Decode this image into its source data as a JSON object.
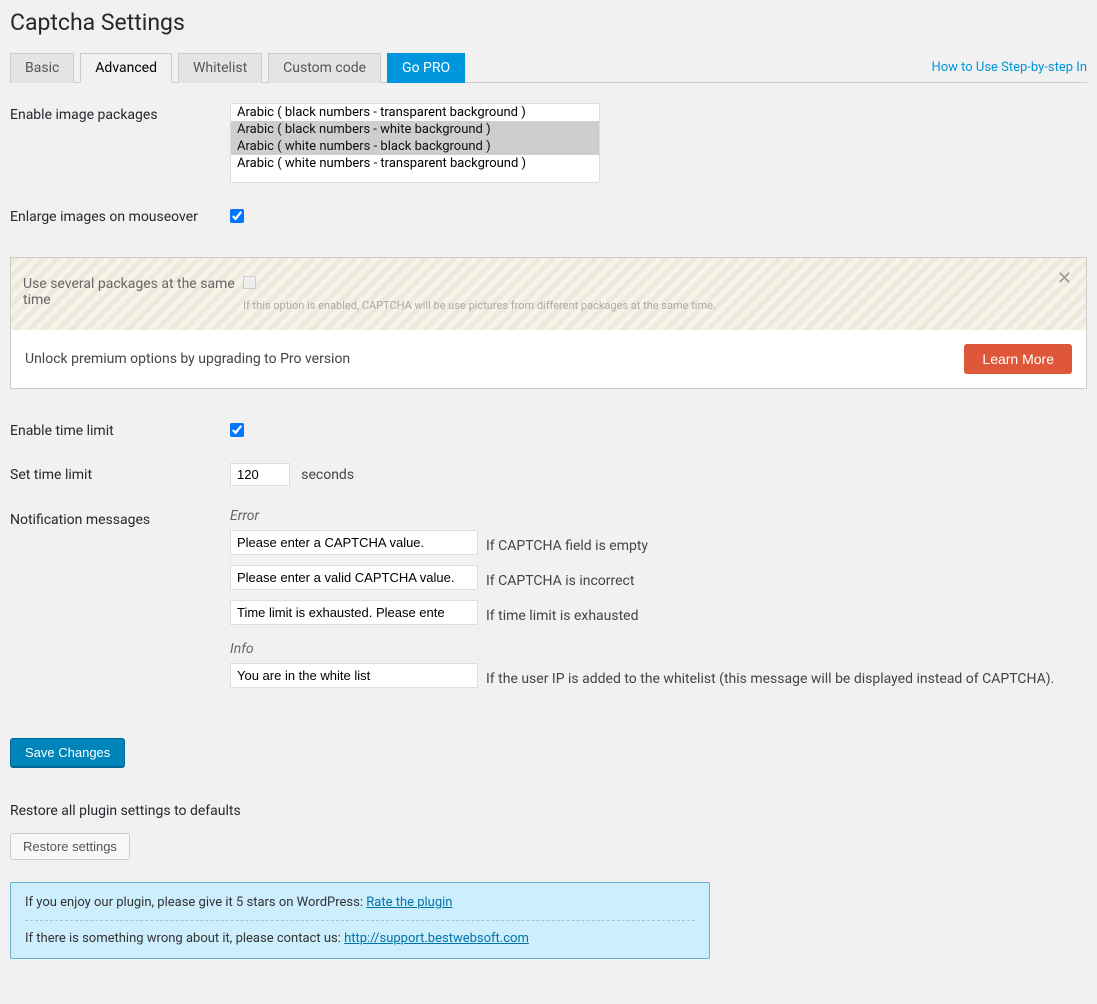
{
  "page_title": "Captcha Settings",
  "tabs": {
    "basic": "Basic",
    "advanced": "Advanced",
    "whitelist": "Whitelist",
    "custom_code": "Custom code",
    "go_pro": "Go PRO"
  },
  "help_link": "How to Use Step-by-step In",
  "fields": {
    "enable_image_packages": "Enable image packages",
    "enlarge_images": "Enlarge images on mouseover",
    "use_several_packages": "Use several packages at the same time",
    "use_several_desc": "If this option is enabled, CAPTCHA will be use pictures from different packages at the same time.",
    "enable_time_limit": "Enable time limit",
    "set_time_limit": "Set time limit",
    "time_limit_value": "120",
    "seconds": "seconds",
    "notification_messages": "Notification messages"
  },
  "image_packages": {
    "opt1": "Arabic ( black numbers - transparent background )",
    "opt2": "Arabic ( black numbers - white background )",
    "opt3": "Arabic ( white numbers - black background )",
    "opt4": "Arabic ( white numbers - transparent background )"
  },
  "premium": {
    "unlock_text": "Unlock premium options by upgrading to Pro version",
    "learn_more": "Learn More"
  },
  "notifications": {
    "error_label": "Error",
    "error1_value": "Please enter a CAPTCHA value.",
    "error1_desc": "If CAPTCHA field is empty",
    "error2_value": "Please enter a valid CAPTCHA value.",
    "error2_desc": "If CAPTCHA is incorrect",
    "error3_value": "Time limit is exhausted. Please ente",
    "error3_desc": "If time limit is exhausted",
    "info_label": "Info",
    "info1_value": "You are in the white list",
    "info1_desc": "If the user IP is added to the whitelist (this message will be displayed instead of CAPTCHA)."
  },
  "save_button": "Save Changes",
  "restore": {
    "label": "Restore all plugin settings to defaults",
    "button": "Restore settings"
  },
  "notice": {
    "top_text": "If you enjoy our plugin, please give it 5 stars on WordPress: ",
    "top_link": "Rate the plugin",
    "bottom_text": "If there is something wrong about it, please contact us: ",
    "bottom_link": "http://support.bestwebsoft.com"
  }
}
